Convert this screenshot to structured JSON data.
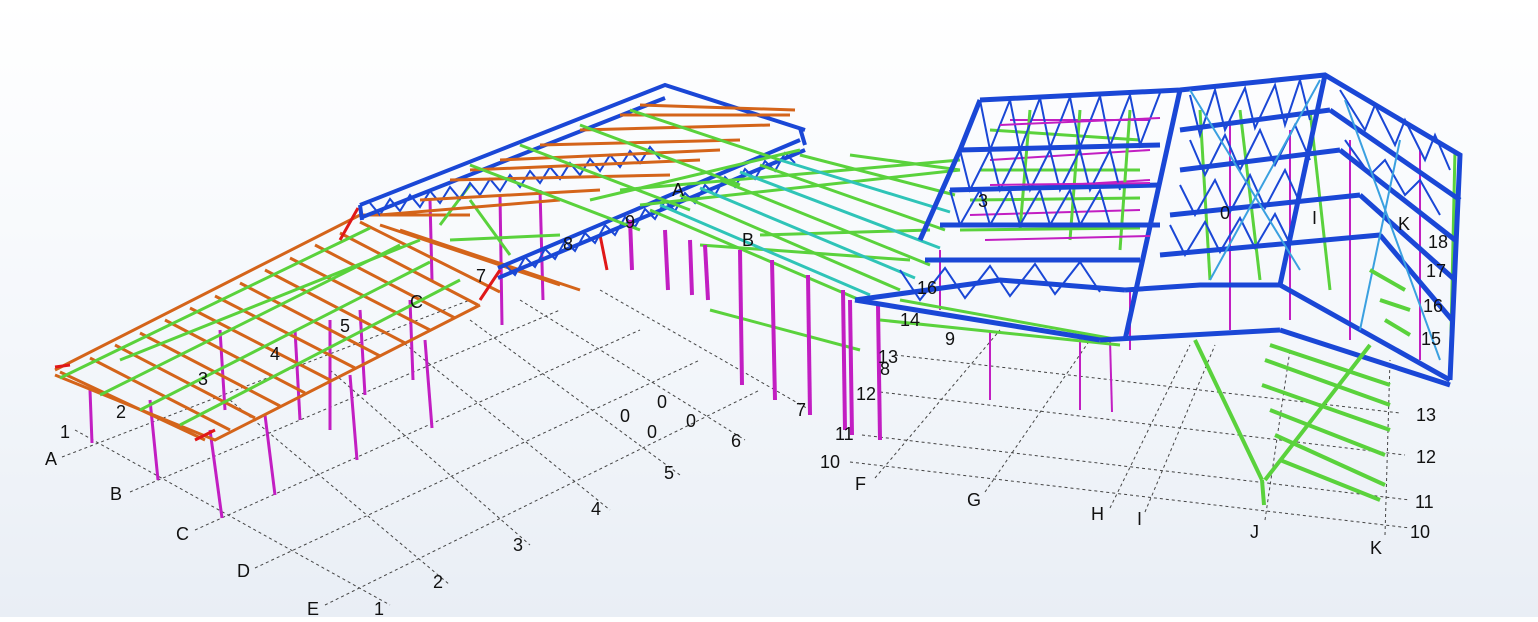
{
  "model_view": {
    "colors": {
      "background": "#f4f7fb",
      "grid_line": "#444444",
      "truss_blue": "#1a47d6",
      "light_blue": "#3aa0e0",
      "column_magenta": "#c21ec2",
      "beam_green": "#5ad23c",
      "beam_orange": "#d4641a",
      "brace_red": "#e01818",
      "cyan": "#2fc4b8"
    },
    "grid_labels": {
      "left_letters": [
        "A",
        "B",
        "C",
        "D",
        "E"
      ],
      "left_numbers": [
        "1",
        "2",
        "3",
        "4",
        "5",
        "6",
        "7"
      ],
      "left_structure_numbers": [
        "1",
        "2",
        "3",
        "4",
        "5",
        "7",
        "8",
        "9"
      ],
      "left_structure_letter": "C",
      "zeros": [
        "0",
        "0",
        "0",
        "0"
      ],
      "right_letters": [
        "F",
        "G",
        "H",
        "I",
        "J",
        "K"
      ],
      "right_numbers": [
        "10",
        "11",
        "12",
        "13",
        "14",
        "15",
        "16",
        "17",
        "18"
      ],
      "right_front_numbers": [
        "10",
        "11",
        "12",
        "13"
      ],
      "mid_numbers": [
        "8",
        "9",
        "16"
      ],
      "mid_letters": [
        "A",
        "B"
      ],
      "roof_numbers": [
        "3",
        "0"
      ],
      "roof_letters": [
        "I",
        "K"
      ]
    }
  }
}
